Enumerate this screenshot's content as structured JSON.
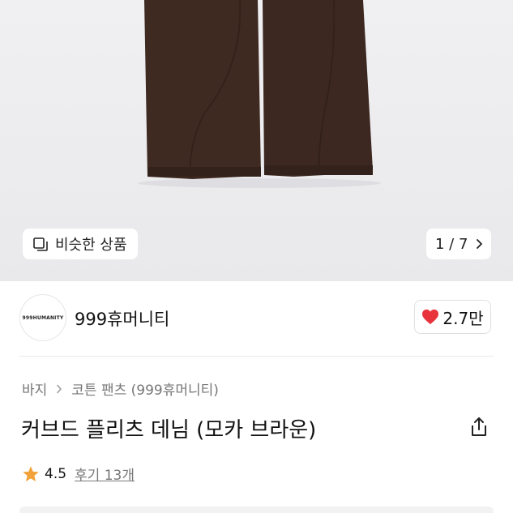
{
  "gallery": {
    "similar_label": "비슷한 상품",
    "pager": "1 / 7",
    "icons": {
      "similar": "similar-items-icon",
      "next": "chevron-right-icon"
    }
  },
  "brand": {
    "logo_text": "999HUMANITY",
    "name": "999휴머니티"
  },
  "like": {
    "count": "2.7만",
    "icon": "heart-icon",
    "color": "#e8333d"
  },
  "breadcrumb": {
    "level1": "바지",
    "level2": "코튼 팬츠 (999휴머니티)"
  },
  "product": {
    "title": "커브드 플리츠 데님 (모카 브라운)"
  },
  "rating": {
    "score": "4.5",
    "reviews": "후기 13개",
    "star_color": "#f2a23a"
  }
}
